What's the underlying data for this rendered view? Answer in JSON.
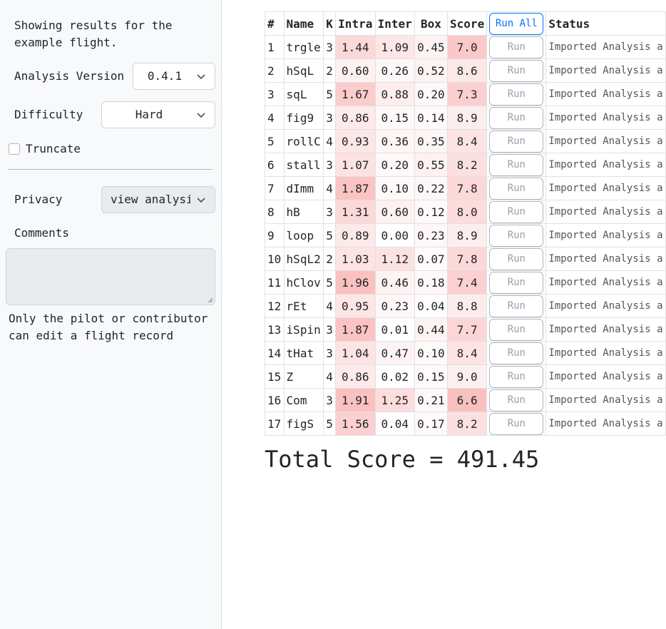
{
  "sidebar": {
    "intro": "Showing results for the example flight.",
    "analysis_version_label": "Analysis Version",
    "analysis_version_value": "0.4.1",
    "difficulty_label": "Difficulty",
    "difficulty_value": "Hard",
    "truncate_label": "Truncate",
    "privacy_label": "Privacy",
    "privacy_value": "view analysis",
    "comments_label": "Comments",
    "comments_value": "",
    "note": "Only the pilot or contributor can edit a flight record"
  },
  "table": {
    "headers": {
      "idx": "#",
      "name": "Name",
      "k": "K",
      "intra": "Intra",
      "inter": "Inter",
      "box": "Box",
      "score": "Score",
      "run_all": "Run All",
      "status": "Status"
    },
    "run_label": "Run",
    "rows": [
      {
        "idx": "1",
        "name": "trgle",
        "k": "3",
        "intra": "1.44",
        "inter": "1.09",
        "box": "0.45",
        "score": "7.0",
        "status": "Imported Analysis a",
        "intra_bg": "#fcd9d9",
        "inter_bg": "#fde6e6",
        "box_bg": "#fef3f3",
        "score_bg": "#fbc8c8"
      },
      {
        "idx": "2",
        "name": "hSqL",
        "k": "2",
        "intra": "0.60",
        "inter": "0.26",
        "box": "0.52",
        "score": "8.6",
        "status": "Imported Analysis a",
        "intra_bg": "#fef1f1",
        "inter_bg": "#fff7f7",
        "box_bg": "#fef2f2",
        "score_bg": "#fde8e8"
      },
      {
        "idx": "3",
        "name": "sqL",
        "k": "5",
        "intra": "1.67",
        "inter": "0.88",
        "box": "0.20",
        "score": "7.3",
        "status": "Imported Analysis a",
        "intra_bg": "#fbcccc",
        "inter_bg": "#feeded",
        "box_bg": "#fff8f8",
        "score_bg": "#fbcfcf"
      },
      {
        "idx": "4",
        "name": "fig9",
        "k": "3",
        "intra": "0.86",
        "inter": "0.15",
        "box": "0.14",
        "score": "8.9",
        "status": "Imported Analysis a",
        "intra_bg": "#feeaea",
        "inter_bg": "#fff9f9",
        "box_bg": "#fff9f9",
        "score_bg": "#fdeeee"
      },
      {
        "idx": "5",
        "name": "rollC",
        "k": "4",
        "intra": "0.93",
        "inter": "0.36",
        "box": "0.35",
        "score": "8.4",
        "status": "Imported Analysis a",
        "intra_bg": "#fde6e6",
        "inter_bg": "#fff5f5",
        "box_bg": "#fef5f5",
        "score_bg": "#fde4e4"
      },
      {
        "idx": "6",
        "name": "stall",
        "k": "3",
        "intra": "1.07",
        "inter": "0.20",
        "box": "0.55",
        "score": "8.2",
        "status": "Imported Analysis a",
        "intra_bg": "#fde2e2",
        "inter_bg": "#fff8f8",
        "box_bg": "#fef1f1",
        "score_bg": "#fce0e0"
      },
      {
        "idx": "7",
        "name": "dImm",
        "k": "4",
        "intra": "1.87",
        "inter": "0.10",
        "box": "0.22",
        "score": "7.8",
        "status": "Imported Analysis a",
        "intra_bg": "#fbc3c3",
        "inter_bg": "#fffafa",
        "box_bg": "#fff7f7",
        "score_bg": "#fcd8d8"
      },
      {
        "idx": "8",
        "name": "hB",
        "k": "3",
        "intra": "1.31",
        "inter": "0.60",
        "box": "0.12",
        "score": "8.0",
        "status": "Imported Analysis a",
        "intra_bg": "#fcd9d9",
        "inter_bg": "#fef1f1",
        "box_bg": "#fffafa",
        "score_bg": "#fcdcdc"
      },
      {
        "idx": "9",
        "name": "loop",
        "k": "5",
        "intra": "0.89",
        "inter": "0.00",
        "box": "0.23",
        "score": "8.9",
        "status": "Imported Analysis a",
        "intra_bg": "#fee9e9",
        "inter_bg": "#ffffff",
        "box_bg": "#fff7f7",
        "score_bg": "#fdeeee"
      },
      {
        "idx": "10",
        "name": "hSqL2",
        "k": "2",
        "intra": "1.03",
        "inter": "1.12",
        "box": "0.07",
        "score": "7.8",
        "status": "Imported Analysis a",
        "intra_bg": "#fde3e3",
        "inter_bg": "#fde2e2",
        "box_bg": "#fffbfb",
        "score_bg": "#fcd8d8"
      },
      {
        "idx": "11",
        "name": "hClov",
        "k": "5",
        "intra": "1.96",
        "inter": "0.46",
        "box": "0.18",
        "score": "7.4",
        "status": "Imported Analysis a",
        "intra_bg": "#fbc0c0",
        "inter_bg": "#fef3f3",
        "box_bg": "#fff8f8",
        "score_bg": "#fbd0d0"
      },
      {
        "idx": "12",
        "name": "rEt",
        "k": "4",
        "intra": "0.95",
        "inter": "0.23",
        "box": "0.04",
        "score": "8.8",
        "status": "Imported Analysis a",
        "intra_bg": "#fee6e6",
        "inter_bg": "#fff7f7",
        "box_bg": "#fffdfd",
        "score_bg": "#fdecec"
      },
      {
        "idx": "13",
        "name": "iSpin",
        "k": "3",
        "intra": "1.87",
        "inter": "0.01",
        "box": "0.44",
        "score": "7.7",
        "status": "Imported Analysis a",
        "intra_bg": "#fbc3c3",
        "inter_bg": "#ffffff",
        "box_bg": "#fef3f3",
        "score_bg": "#fcd6d6"
      },
      {
        "idx": "14",
        "name": "tHat",
        "k": "3",
        "intra": "1.04",
        "inter": "0.47",
        "box": "0.10",
        "score": "8.4",
        "status": "Imported Analysis a",
        "intra_bg": "#fde3e3",
        "inter_bg": "#fef3f3",
        "box_bg": "#fffafa",
        "score_bg": "#fde4e4"
      },
      {
        "idx": "15",
        "name": "Z",
        "k": "4",
        "intra": "0.86",
        "inter": "0.02",
        "box": "0.15",
        "score": "9.0",
        "status": "Imported Analysis a",
        "intra_bg": "#feeaea",
        "inter_bg": "#ffffff",
        "box_bg": "#fff9f9",
        "score_bg": "#fdf0f0"
      },
      {
        "idx": "16",
        "name": "Com",
        "k": "3",
        "intra": "1.91",
        "inter": "1.25",
        "box": "0.21",
        "score": "6.6",
        "status": "Imported Analysis a",
        "intra_bg": "#fbc1c1",
        "inter_bg": "#fcdcdc",
        "box_bg": "#fff8f8",
        "score_bg": "#fabfbf"
      },
      {
        "idx": "17",
        "name": "figS",
        "k": "5",
        "intra": "1.56",
        "inter": "0.04",
        "box": "0.17",
        "score": "8.2",
        "status": "Imported Analysis a",
        "intra_bg": "#fcd0d0",
        "inter_bg": "#fffdfd",
        "box_bg": "#fff9f9",
        "score_bg": "#fce0e0"
      }
    ]
  },
  "total": "Total Score = 491.45",
  "colors": {
    "accent": "#0d6efd",
    "sidebar_bg": "#f8f9fa",
    "border": "#dee2e6"
  }
}
